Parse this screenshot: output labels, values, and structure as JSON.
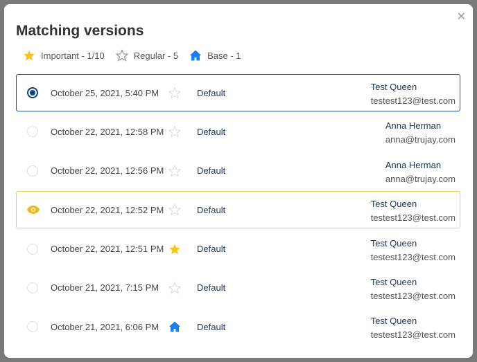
{
  "title": "Matching versions",
  "close_icon": "close-icon",
  "legend": [
    {
      "icon": "star-filled",
      "label": "Important - 1/10"
    },
    {
      "icon": "star-outline",
      "label": "Regular - 5"
    },
    {
      "icon": "home",
      "label": "Base - 1"
    }
  ],
  "colors": {
    "selected": "#0e4483",
    "viewing": "#f5c542",
    "star": "#f5c518",
    "home": "#1a7ff0"
  },
  "versions": [
    {
      "date": "October 25, 2021, 5:40 PM",
      "mark": "star-outline",
      "branch": "Default",
      "name": "Test Queen",
      "email": "testest123@test.com",
      "state": "selected"
    },
    {
      "date": "October 22, 2021, 12:58 PM",
      "mark": "star-outline",
      "branch": "Default",
      "name": "Anna Herman",
      "email": "anna@trujay.com",
      "state": ""
    },
    {
      "date": "October 22, 2021, 12:56 PM",
      "mark": "star-outline",
      "branch": "Default",
      "name": "Anna Herman",
      "email": "anna@trujay.com",
      "state": ""
    },
    {
      "date": "October 22, 2021, 12:52 PM",
      "mark": "star-outline",
      "branch": "Default",
      "name": "Test Queen",
      "email": "testest123@test.com",
      "state": "viewing"
    },
    {
      "date": "October 22, 2021, 12:51 PM",
      "mark": "star-filled",
      "branch": "Default",
      "name": "Test Queen",
      "email": "testest123@test.com",
      "state": ""
    },
    {
      "date": "October 21, 2021, 7:15 PM",
      "mark": "star-outline",
      "branch": "Default",
      "name": "Test Queen",
      "email": "testest123@test.com",
      "state": ""
    },
    {
      "date": "October 21, 2021, 6:06 PM",
      "mark": "home",
      "branch": "Default",
      "name": "Test Queen",
      "email": "testest123@test.com",
      "state": ""
    }
  ]
}
